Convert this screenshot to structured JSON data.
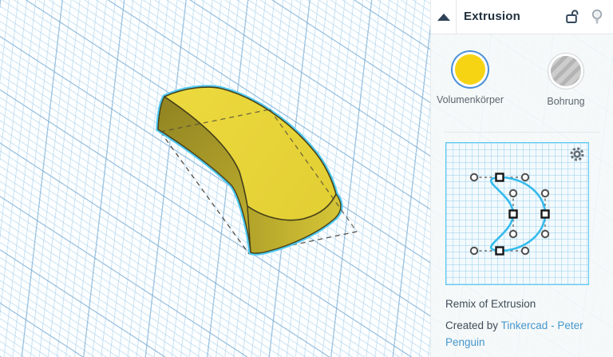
{
  "inspector": {
    "title": "Extrusion",
    "icons": {
      "collapse": "collapse-up-triangle-icon",
      "lock": "unlocked-padlock-icon",
      "hint": "lightbulb-icon",
      "gear": "settings-gear-icon"
    },
    "options": [
      {
        "label": "Volumenkörper",
        "selected": true,
        "style": "solid-yellow-circle",
        "fill": "#f6d414",
        "ring": "#4a90d9"
      },
      {
        "label": "Bohrung",
        "selected": false,
        "style": "gray-striped-circle"
      }
    ],
    "profile_editor": {
      "description": "2D crescent profile with bezier anchors and handles",
      "curve_color": "#35bbec",
      "anchor_count": 4
    },
    "credits": {
      "remix_label": "Remix of Extrusion",
      "created_by_prefix": "Created by ",
      "created_by_link": "Tinkercad - Peter Penguin"
    }
  },
  "canvas": {
    "selected_shape": "yellow crescent extrusion",
    "selection_outline_color": "#4ec9f2",
    "shape_top_color": "#e7d53a",
    "shape_side_color": "#b3a42c",
    "bounding_box_style": "dashed"
  }
}
